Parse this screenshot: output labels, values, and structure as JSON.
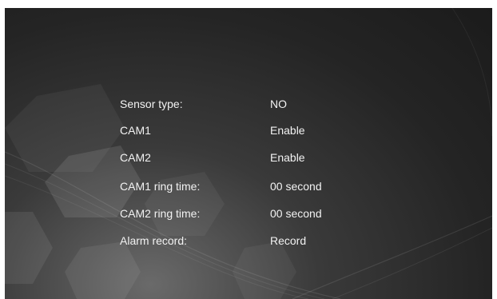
{
  "settings": {
    "rows": [
      {
        "label": "Sensor type:",
        "value": "NO"
      },
      {
        "label": "CAM1",
        "value": "Enable"
      },
      {
        "label": "CAM2",
        "value": "Enable"
      },
      {
        "label": "CAM1 ring time:",
        "value": "00 second"
      },
      {
        "label": "CAM2 ring time:",
        "value": "00 second"
      },
      {
        "label": "Alarm record:",
        "value": "Record"
      }
    ]
  },
  "colors": {
    "background": "#242424",
    "text": "#f2f2f2"
  }
}
